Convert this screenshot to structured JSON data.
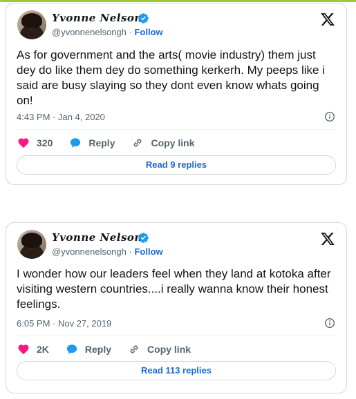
{
  "tweets": [
    {
      "display_name": "Yvonne Nelson",
      "handle": "@yvonnenelsongh",
      "separator": "·",
      "follow_label": "Follow",
      "text": "As for government and the arts( movie industry) them just dey do like them dey do something kerkerh. My peeps like i said are busy slaying so they dont even know whats going on!",
      "timestamp": "4:43 PM · Jan 4, 2020",
      "likes": "320",
      "reply_label": "Reply",
      "copy_link_label": "Copy link",
      "read_replies_label": "Read 9 replies"
    },
    {
      "display_name": "Yvonne Nelson",
      "handle": "@yvonnenelsongh",
      "separator": "·",
      "follow_label": "Follow",
      "text": "I wonder how our leaders feel when they land at kotoka after visiting western countries....i really wanna know their honest feelings.",
      "timestamp": "6:05 PM · Nov 27, 2019",
      "likes": "2K",
      "reply_label": "Reply",
      "copy_link_label": "Copy link",
      "read_replies_label": "Read 113 replies"
    }
  ],
  "icons": {
    "verified": "verified-badge-icon",
    "x_logo": "x-logo-icon",
    "info": "info-icon",
    "heart": "heart-icon",
    "reply": "reply-bubble-icon",
    "link": "link-icon"
  },
  "colors": {
    "accent_blue": "#1d6ad1",
    "heart_pink": "#f91880",
    "verified_blue": "#1d9bf0",
    "secondary_text": "#536471",
    "border": "#cfd9de",
    "top_bar": "#9acd32"
  }
}
